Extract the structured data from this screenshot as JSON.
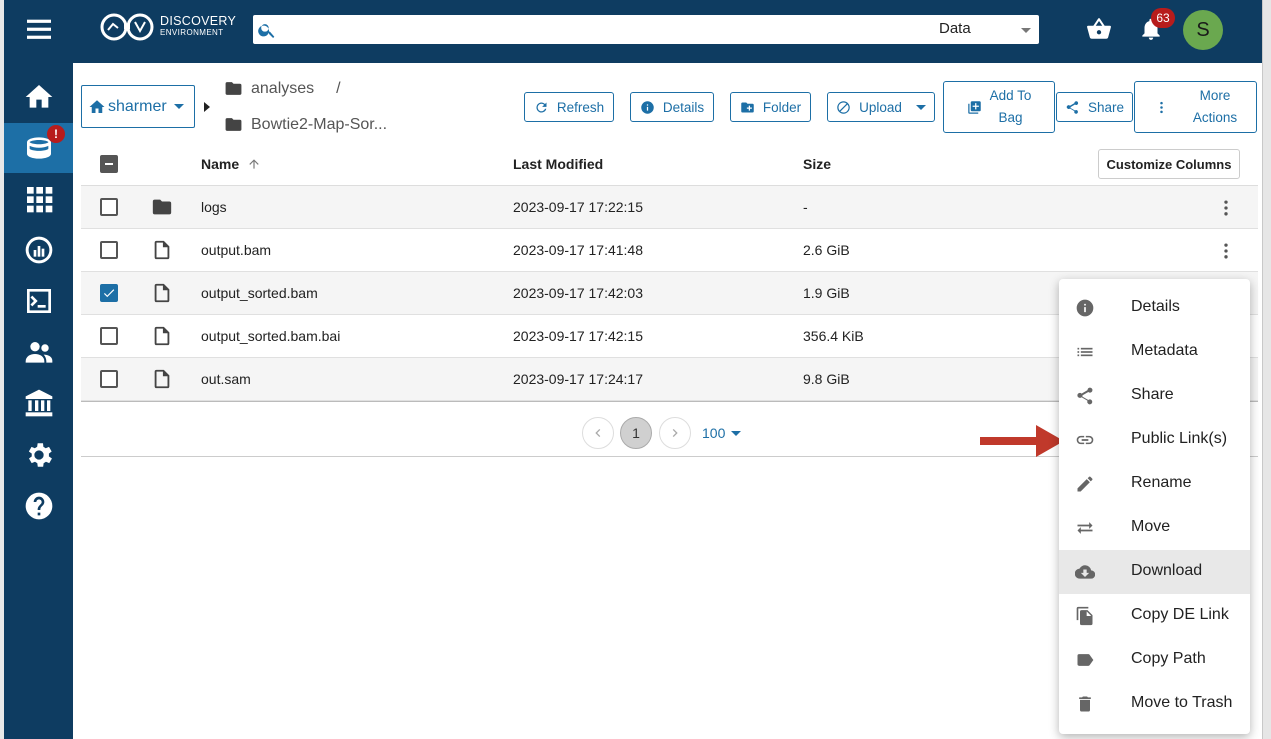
{
  "app": {
    "name_line1": "DISCOVERY",
    "name_line2": "ENVIRONMENT"
  },
  "sidebar": {
    "items": [
      {
        "name": "home",
        "icon": "home-icon"
      },
      {
        "name": "data",
        "icon": "data-icon",
        "active": true,
        "badge": "!"
      },
      {
        "name": "apps",
        "icon": "apps-icon"
      },
      {
        "name": "analyses",
        "icon": "analyses-icon"
      },
      {
        "name": "vice",
        "icon": "terminal-icon"
      },
      {
        "name": "teams",
        "icon": "teams-icon"
      },
      {
        "name": "collections",
        "icon": "institution-icon"
      },
      {
        "name": "settings",
        "icon": "gear-icon"
      },
      {
        "name": "help",
        "icon": "help-icon"
      }
    ]
  },
  "header": {
    "search_value": "",
    "search_scope": "Data",
    "notifications_count": "63",
    "avatar_initial": "S"
  },
  "toolbar": {
    "user": "sharmer",
    "breadcrumb": [
      "analyses",
      "Bowtie2-Map-Sor..."
    ],
    "breadcrumb_sep": "/",
    "refresh": "Refresh",
    "details": "Details",
    "folder": "Folder",
    "upload": "Upload",
    "add_to_bag_1": "Add To",
    "add_to_bag_2": "Bag",
    "share": "Share",
    "more_actions_1": "More",
    "more_actions_2": "Actions"
  },
  "table": {
    "columns": {
      "name": "Name",
      "modified": "Last Modified",
      "size": "Size"
    },
    "customize_columns": "Customize Columns",
    "rows": [
      {
        "name": "logs",
        "modified": "2023-09-17 17:22:15",
        "size": "-",
        "type": "folder",
        "checked": false
      },
      {
        "name": "output.bam",
        "modified": "2023-09-17 17:41:48",
        "size": "2.6 GiB",
        "type": "file",
        "checked": false
      },
      {
        "name": "output_sorted.bam",
        "modified": "2023-09-17 17:42:03",
        "size": "1.9 GiB",
        "type": "file",
        "checked": true
      },
      {
        "name": "output_sorted.bam.bai",
        "modified": "2023-09-17 17:42:15",
        "size": "356.4 KiB",
        "type": "file",
        "checked": false
      },
      {
        "name": "out.sam",
        "modified": "2023-09-17 17:24:17",
        "size": "9.8 GiB",
        "type": "file",
        "checked": false
      }
    ]
  },
  "pagination": {
    "current_page": "1",
    "page_size": "100"
  },
  "context_menu": {
    "items": [
      {
        "label": "Details",
        "icon": "info-icon"
      },
      {
        "label": "Metadata",
        "icon": "list-icon"
      },
      {
        "label": "Share",
        "icon": "share-icon"
      },
      {
        "label": "Public Link(s)",
        "icon": "link-icon"
      },
      {
        "label": "Rename",
        "icon": "pencil-icon"
      },
      {
        "label": "Move",
        "icon": "swap-icon"
      },
      {
        "label": "Download",
        "icon": "cloud-download-icon",
        "highlighted": true
      },
      {
        "label": "Copy DE Link",
        "icon": "copy-icon"
      },
      {
        "label": "Copy Path",
        "icon": "label-icon"
      },
      {
        "label": "Move to Trash",
        "icon": "trash-icon"
      }
    ]
  },
  "colors": {
    "nav": "#0e3c61",
    "accent": "#1d6fa6",
    "badge": "#b71c1c",
    "avatar": "#6aa84f",
    "annotation_arrow": "#c0392b"
  }
}
